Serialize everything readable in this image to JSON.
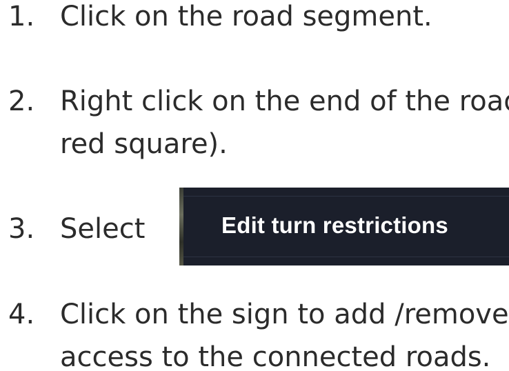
{
  "steps": [
    {
      "number": "1.",
      "lines": [
        "Click on the road segment."
      ]
    },
    {
      "number": "2.",
      "lines": [
        "Right click on the end of the road",
        "red square)."
      ]
    },
    {
      "number": "3.",
      "lines": [
        "Select"
      ]
    },
    {
      "number": "4.",
      "lines": [
        "Click on the sign to add /remove",
        "access to the connected roads."
      ]
    }
  ],
  "context_menu": {
    "item_label": "Edit turn restrictions",
    "background_color": "#1b1f2b",
    "text_color": "#ffffff"
  }
}
